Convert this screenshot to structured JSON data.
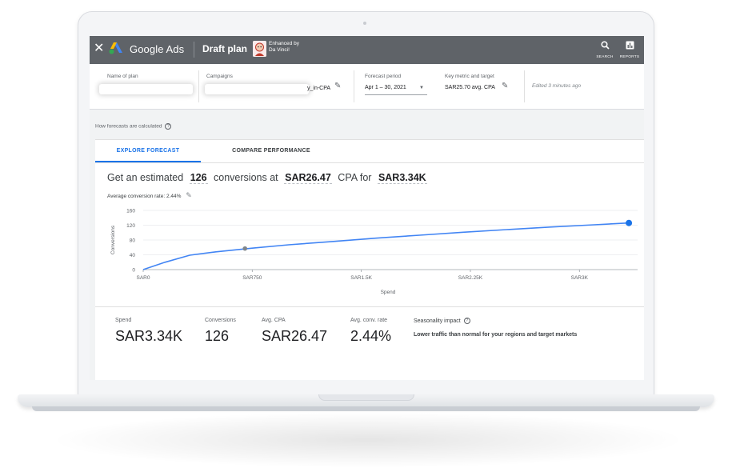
{
  "topbar": {
    "brand": "Google Ads",
    "plan_title": "Draft plan",
    "enhanced_by": "Enhanced by",
    "enhanced_name": "Da Vinci!",
    "search_label": "SEARCH",
    "reports_label": "REPORTS"
  },
  "settings": {
    "name_label": "Name of plan",
    "campaigns_label": "Campaigns",
    "campaigns_suffix": "y_in-CPA",
    "forecast_label": "Forecast period",
    "forecast_value": "Apr 1 – 30, 2021",
    "metric_label": "Key metric and target",
    "metric_value": "SAR25.70 avg. CPA",
    "edited": "Edited 3 minutes ago"
  },
  "how_forecasts": "How forecasts are calculated",
  "tabs": [
    {
      "label": "EXPLORE FORECAST",
      "active": true
    },
    {
      "label": "COMPARE PERFORMANCE",
      "active": false
    }
  ],
  "headline": {
    "p1": "Get an estimated",
    "conversions": "126",
    "p2": "conversions at",
    "cpa": "SAR26.47",
    "p3": "CPA for",
    "spend": "SAR3.34K"
  },
  "avg_conv_rate": "Average conversion rate: 2.44%",
  "chart_data": {
    "type": "line",
    "xlabel": "Spend",
    "ylabel": "Conversions",
    "x_ticks": [
      "SAR0",
      "SAR750",
      "SAR1.5K",
      "SAR2.25K",
      "SAR3K"
    ],
    "x_tick_values": [
      0,
      750,
      1500,
      2250,
      3000
    ],
    "y_ticks": [
      0,
      40,
      80,
      120,
      160
    ],
    "xlim": [
      0,
      3400
    ],
    "ylim": [
      0,
      160
    ],
    "grid": true,
    "series": [
      {
        "x": [
          0,
          150,
          320,
          500,
          750,
          1000,
          1300,
          1600,
          1900,
          2200,
          2500,
          2800,
          3100,
          3340
        ],
        "values": [
          0,
          20,
          39,
          48,
          58,
          67,
          76,
          85,
          93,
          101,
          108,
          115,
          121,
          126
        ]
      }
    ],
    "markers": [
      {
        "x": 700,
        "y": 57,
        "color": "#80868b"
      },
      {
        "x": 3340,
        "y": 126,
        "color": "#1a73e8"
      }
    ],
    "line_color": "#4285f4"
  },
  "stats": [
    {
      "label": "Spend",
      "value": "SAR3.34K"
    },
    {
      "label": "Conversions",
      "value": "126"
    },
    {
      "label": "Avg. CPA",
      "value": "SAR26.47"
    },
    {
      "label": "Avg. conv. rate",
      "value": "2.44%"
    }
  ],
  "seasonality": {
    "title": "Seasonality impact",
    "text": "Lower traffic than normal for your regions and target markets"
  },
  "icons": {
    "close": "close-icon",
    "search": "search-icon",
    "reports": "reports-icon",
    "edit": "pencil-icon",
    "help": "help-icon"
  }
}
